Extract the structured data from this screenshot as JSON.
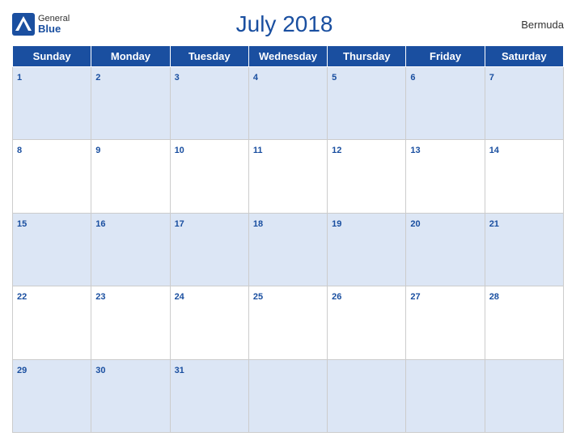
{
  "header": {
    "logo_general": "General",
    "logo_blue": "Blue",
    "title": "July 2018",
    "region": "Bermuda"
  },
  "weekdays": [
    "Sunday",
    "Monday",
    "Tuesday",
    "Wednesday",
    "Thursday",
    "Friday",
    "Saturday"
  ],
  "weeks": [
    [
      1,
      2,
      3,
      4,
      5,
      6,
      7
    ],
    [
      8,
      9,
      10,
      11,
      12,
      13,
      14
    ],
    [
      15,
      16,
      17,
      18,
      19,
      20,
      21
    ],
    [
      22,
      23,
      24,
      25,
      26,
      27,
      28
    ],
    [
      29,
      30,
      31,
      null,
      null,
      null,
      null
    ]
  ]
}
